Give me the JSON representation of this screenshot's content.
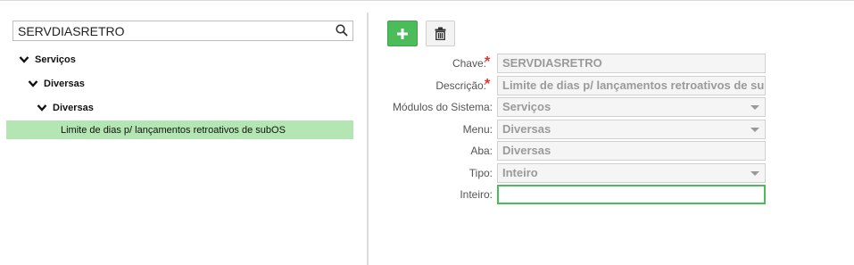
{
  "search": {
    "value": "SERVDIASRETRO"
  },
  "tree": {
    "level1": "Serviços",
    "level2": "Diversas",
    "level3": "Diversas",
    "selected_leaf": "Limite de dias p/ lançamentos retroativos de subOS"
  },
  "form": {
    "chave_label": "Chave:",
    "chave_value": "SERVDIASRETRO",
    "descricao_label": "Descrição:",
    "descricao_value": "Limite de dias p/ lançamentos retroativos de subOS",
    "modulos_label": "Módulos do Sistema:",
    "modulos_value": "Serviços",
    "menu_label": "Menu:",
    "menu_value": "Diversas",
    "aba_label": "Aba:",
    "aba_value": "Diversas",
    "tipo_label": "Tipo:",
    "tipo_value": "Inteiro",
    "inteiro_label": "Inteiro:",
    "inteiro_value": "",
    "required_mark": "*"
  },
  "toolbar": {
    "add_icon": "plus-icon",
    "delete_icon": "trash-icon"
  },
  "colors": {
    "accent": "#4cbc5a",
    "selected_row": "#b3e6b3",
    "required": "#e0352b"
  }
}
